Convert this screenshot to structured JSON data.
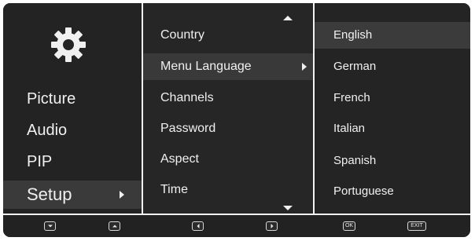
{
  "main_menu": {
    "icon": "gear-icon",
    "items": [
      {
        "label": "Picture"
      },
      {
        "label": "Audio"
      },
      {
        "label": "PIP"
      },
      {
        "label": "Setup",
        "selected": true
      }
    ]
  },
  "setup_menu": {
    "items": [
      {
        "label": "Country"
      },
      {
        "label": "Menu Language",
        "selected": true
      },
      {
        "label": "Channels"
      },
      {
        "label": "Password"
      },
      {
        "label": "Aspect"
      },
      {
        "label": "Time"
      }
    ]
  },
  "language_menu": {
    "items": [
      {
        "label": "English",
        "selected": true
      },
      {
        "label": "German"
      },
      {
        "label": "French"
      },
      {
        "label": "Italian"
      },
      {
        "label": "Spanish"
      },
      {
        "label": "Portuguese"
      }
    ]
  },
  "bottom_bar": {
    "buttons": [
      {
        "icon": "down-button-icon"
      },
      {
        "icon": "up-button-icon"
      },
      {
        "icon": "left-button-icon"
      },
      {
        "icon": "right-button-icon"
      },
      {
        "icon": "ok-button-icon",
        "label": "OK"
      },
      {
        "icon": "exit-button-icon",
        "label": "EXIT"
      }
    ]
  }
}
